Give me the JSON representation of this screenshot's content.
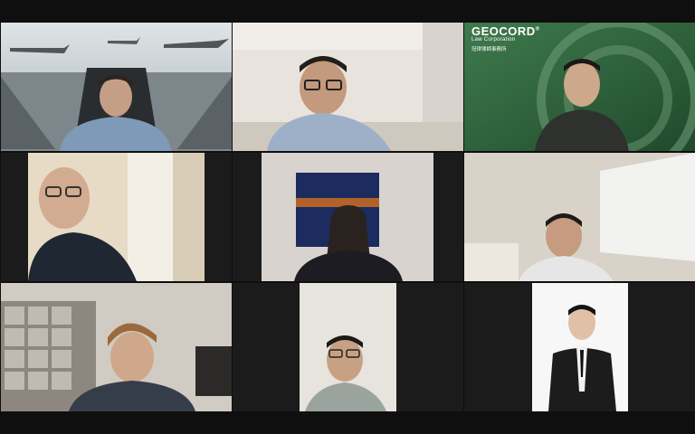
{
  "meeting": {
    "layout": "gallery-3x3",
    "participant_count": 9
  },
  "tiles": [
    {
      "position": 1,
      "background": "fighter-jet-virtual-background"
    },
    {
      "position": 2,
      "background": "office-room"
    },
    {
      "position": 3,
      "background": "geocord-virtual-background",
      "logo": {
        "name": "GEOCORD",
        "registered": "®",
        "subtitle": "Law Corporation",
        "cjk": "冠律律師事務所"
      }
    },
    {
      "position": 4,
      "background": "bright-room"
    },
    {
      "position": 5,
      "background": "wall-with-painting"
    },
    {
      "position": 6,
      "background": "room-with-window-blinds"
    },
    {
      "position": 7,
      "background": "glass-block-wall"
    },
    {
      "position": 8,
      "background": "white-ceiling-room"
    },
    {
      "position": 9,
      "background": "white-studio-portrait"
    }
  ],
  "colors": {
    "app_background": "#0f0f0f",
    "tile_background": "#1b1b1b",
    "geocord_green": "#2f6a3f"
  }
}
